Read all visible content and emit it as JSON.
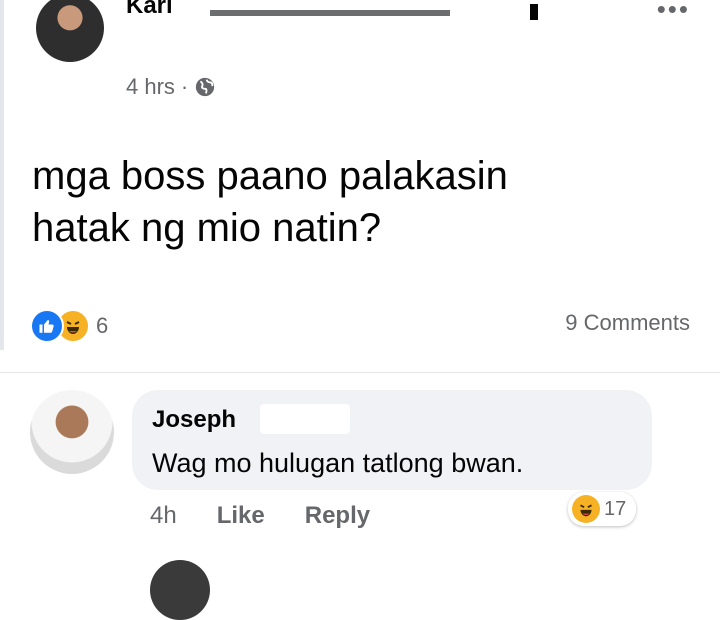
{
  "post": {
    "author": "Karl",
    "time": "4 hrs",
    "separator": "·",
    "body_lines": [
      "mga boss paano palakasin",
      "hatak ng mio natin?"
    ],
    "reaction_count": "6",
    "comments_label": "9 Comments",
    "more_label": "•••"
  },
  "comment": {
    "author": "Joseph",
    "text": "Wag mo hulugan tatlong bwan.",
    "time": "4h",
    "like_label": "Like",
    "reply_label": "Reply",
    "reaction_count": "17"
  },
  "colors": {
    "like_blue": "#1877f2",
    "haha_yellow": "#f7b125",
    "muted_text": "#65676b",
    "bubble_bg": "#f0f2f5"
  },
  "icons": {
    "globe": "globe-icon",
    "like": "like-icon",
    "haha": "haha-icon",
    "more": "more-icon"
  }
}
